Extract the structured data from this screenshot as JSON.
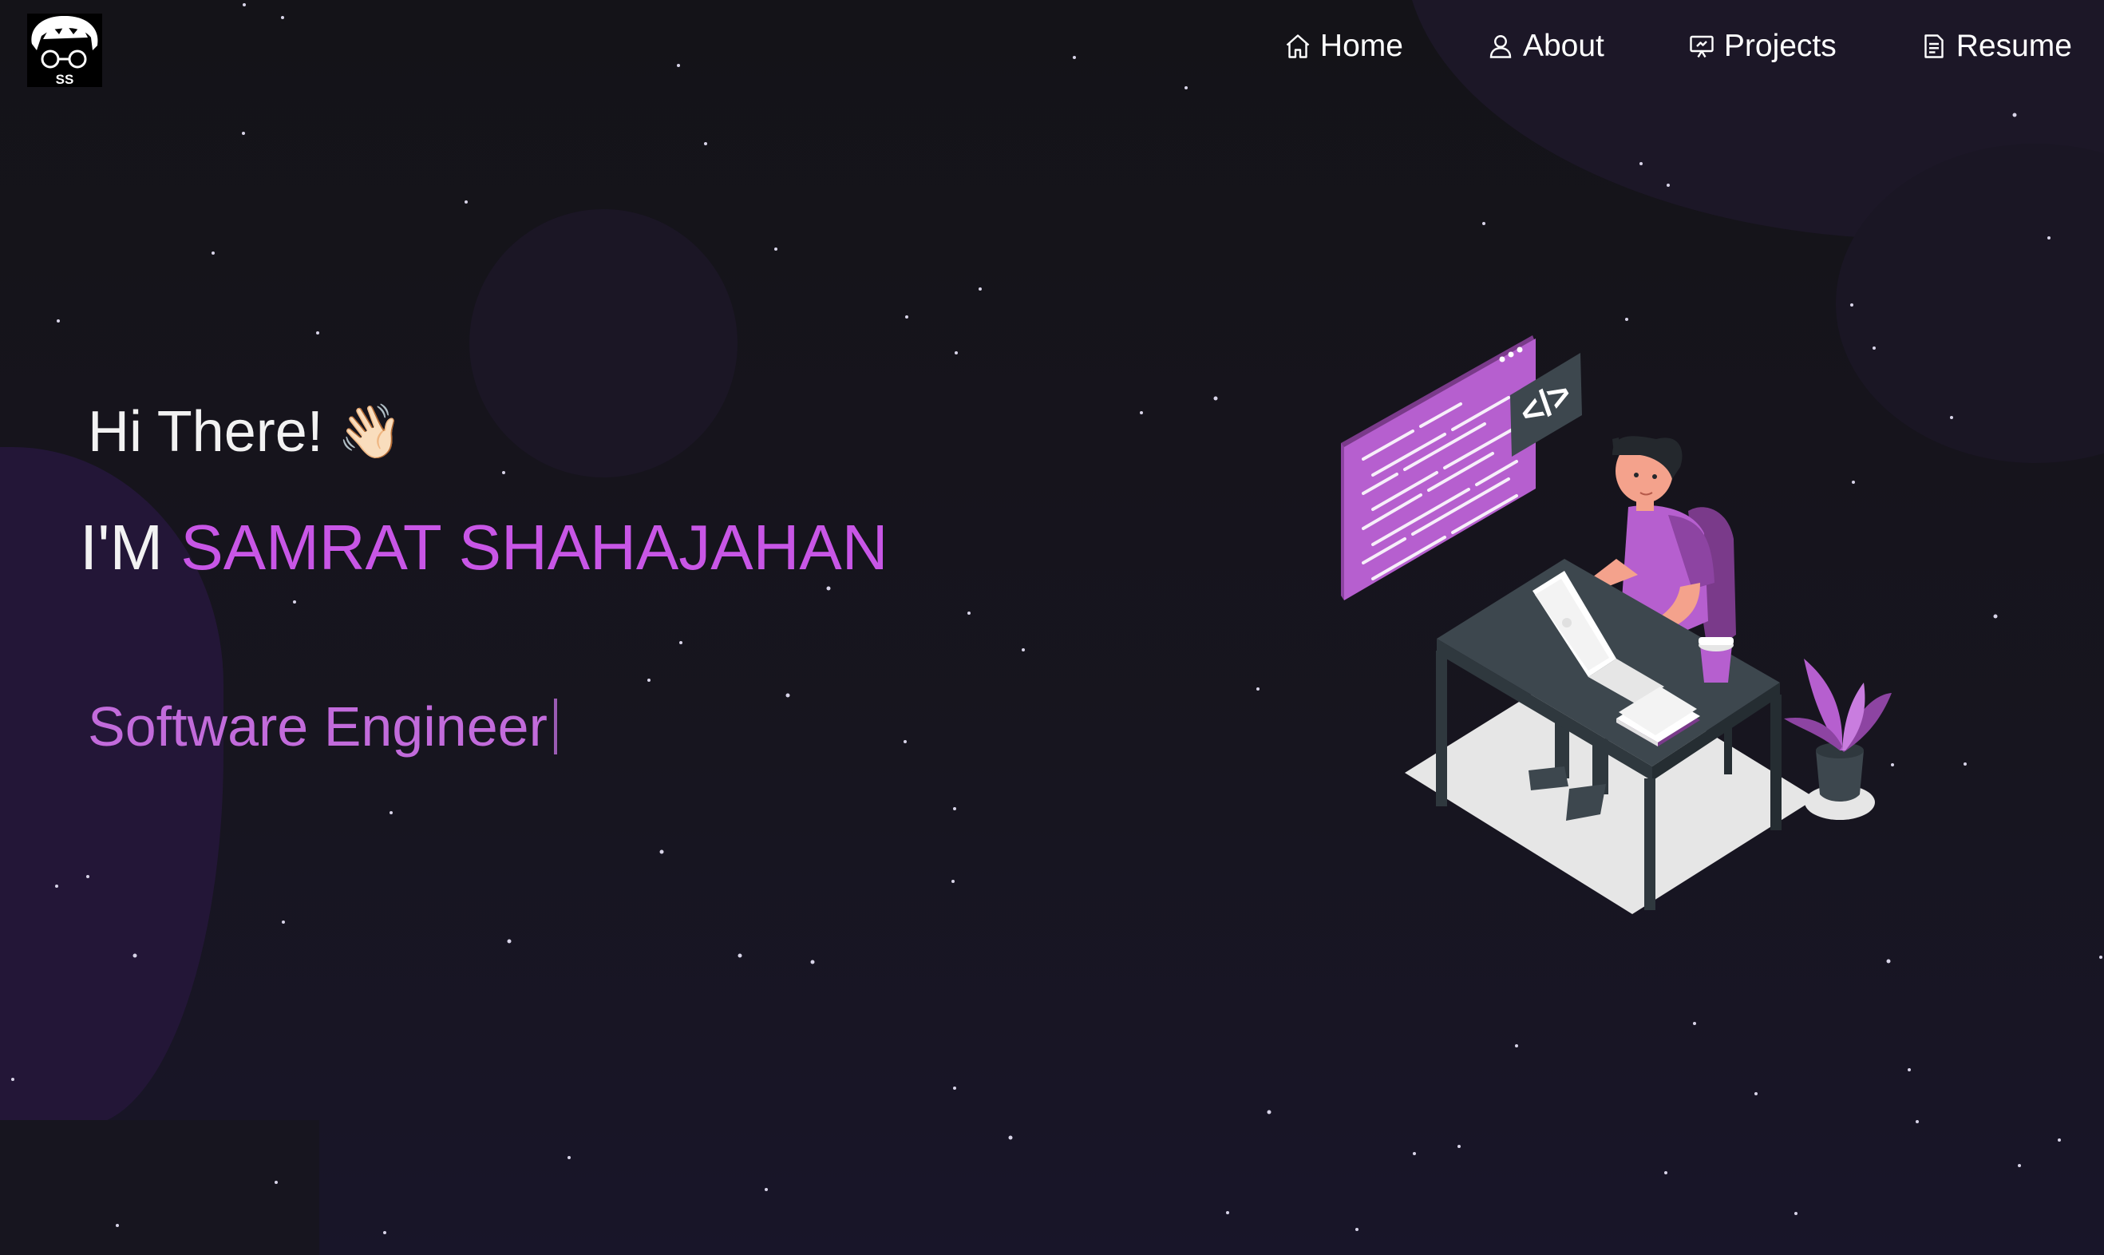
{
  "nav": {
    "items": [
      {
        "label": "Home",
        "icon": "home-icon"
      },
      {
        "label": "About",
        "icon": "user-icon"
      },
      {
        "label": "Projects",
        "icon": "presentation-icon"
      },
      {
        "label": "Resume",
        "icon": "document-icon"
      }
    ]
  },
  "logo": {
    "initials": "SS"
  },
  "hero": {
    "greeting": "Hi There!",
    "wave_emoji": "👋🏻",
    "intro_prefix": "I'M ",
    "name": "SAMRAT SHAHAJAHAN",
    "role": "Software Engineer",
    "code_symbol": "</>"
  },
  "colors": {
    "accent": "#c856e6",
    "role_text": "#c26bdb",
    "background": "#15141c"
  }
}
